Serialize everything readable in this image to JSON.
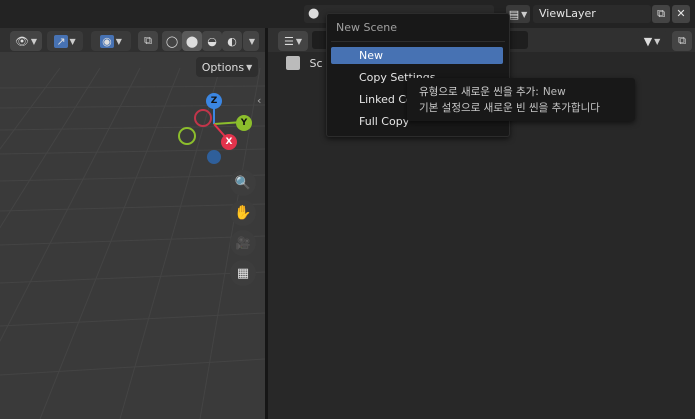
{
  "popup": {
    "title": "New Scene",
    "items": [
      "New",
      "Copy Settings",
      "Linked Copy",
      "Full Copy"
    ],
    "active_index": 0
  },
  "tooltip": {
    "line1_prefix": "유형으로 새로운 씬을 추가:",
    "line1_value": "New",
    "line2": "기본 설정으로 새로운 빈 씬을 추가합니다"
  },
  "header": {
    "view_layer": "ViewLayer",
    "options_label": "Options",
    "scene_partial": "Sc"
  },
  "gizmo": {
    "z": "Z",
    "y": "Y",
    "x": "X"
  },
  "colors": {
    "active_item": "#4772b3",
    "axis_x": "#e3334c",
    "axis_y": "#8cbe2c",
    "axis_z": "#3b86e2"
  }
}
